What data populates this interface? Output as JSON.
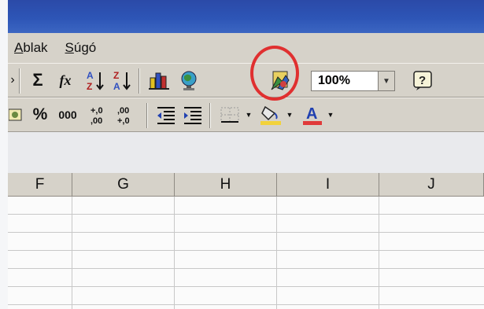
{
  "menu": {
    "items": [
      {
        "u": "A",
        "rest": "blak"
      },
      {
        "u": "S",
        "rest": "úgó"
      }
    ]
  },
  "toolbar1": {
    "sigma": "Σ",
    "fx": "fx",
    "sort_az_a": "A",
    "sort_az_z": "Z",
    "sort_za_z": "Z",
    "sort_za_a": "A",
    "zoom": "100%"
  },
  "toolbar2": {
    "percent": "%",
    "thousands": "000",
    "inc_dec_top": "+,0",
    "inc_dec_bot": ",00",
    "dec_dec_top": ",00",
    "dec_dec_bot": "+,0",
    "font_color_letter": "A"
  },
  "grid": {
    "columns": [
      "F",
      "G",
      "H",
      "I",
      "J"
    ]
  },
  "colors": {
    "highlight": "#e03030",
    "fill_yellow": "#f2d23b",
    "font_red": "#e03a3a"
  }
}
